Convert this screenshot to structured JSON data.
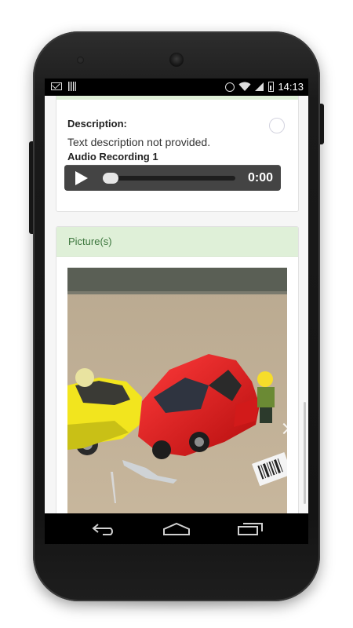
{
  "status_bar": {
    "time": "14:13",
    "left_icons": [
      "gmail-icon",
      "barcode-icon"
    ],
    "right_icons": [
      "alarm-icon",
      "wifi-icon",
      "signal-icon",
      "battery-icon"
    ]
  },
  "description_card": {
    "description_label": "Description:",
    "description_text": "Text description not provided.",
    "audio_label": "Audio Recording 1",
    "audio_time": "0:00",
    "audio_progress": 0
  },
  "pictures_card": {
    "header": "Picture(s)",
    "image_subject": "toy-cars-collision-photo"
  },
  "nav_bar": {
    "icons": [
      "back-icon",
      "home-icon",
      "recents-icon"
    ]
  },
  "colors": {
    "card_header_bg": "#dff0d8",
    "card_header_text": "#3c763d",
    "player_bg": "#444444"
  }
}
